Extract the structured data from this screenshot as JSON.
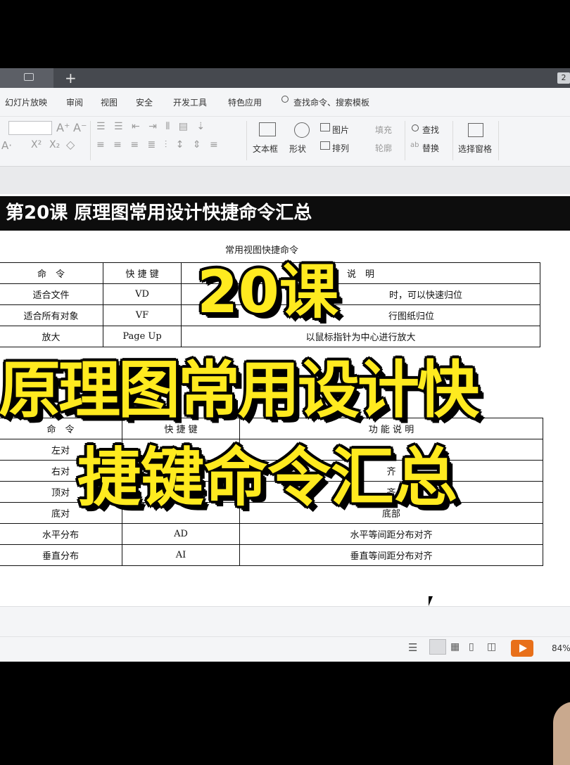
{
  "tabs": {
    "plus": "+",
    "count": "2"
  },
  "menu": [
    "幻灯片放映",
    "审阅",
    "视图",
    "安全",
    "开发工具",
    "特色应用",
    "查找命令、搜索模板"
  ],
  "ribbon": {
    "textbox": "文本框",
    "shape": "形状",
    "picture": "图片",
    "arrange": "排列",
    "fill": "填充",
    "outline": "轮廓",
    "find": "查找",
    "replace": "替换",
    "selection_pane": "选择窗格"
  },
  "slide": {
    "lesson_title": "第20课 原理图常用设计快捷命令汇总",
    "view_table_title": "常用视图快捷命令",
    "view_table": {
      "headers": [
        "命　令",
        "快 捷 键",
        "说　明"
      ],
      "rows": [
        [
          "适合文件",
          "VD",
          "时，可以快速归位"
        ],
        [
          "适合所有对象",
          "VF",
          "行图纸归位"
        ],
        [
          "放大",
          "Page Up",
          "以鼠标指针为中心进行放大"
        ]
      ]
    },
    "align_table": {
      "headers": [
        "命　令",
        "快 捷 键",
        "功 能 说 明"
      ],
      "rows": [
        [
          "左对",
          "",
          ""
        ],
        [
          "右对",
          "",
          "齐"
        ],
        [
          "顶对",
          "",
          "齐"
        ],
        [
          "底对",
          "",
          "底部"
        ],
        [
          "水平分布",
          "AD",
          "水平等间距分布对齐"
        ],
        [
          "垂直分布",
          "AI",
          "垂直等间距分布对齐"
        ]
      ]
    }
  },
  "overlay": {
    "line1": "20课",
    "line2": "原理图常用设计快",
    "line3": "捷键命令汇总"
  },
  "status": {
    "zoom": "84%"
  }
}
